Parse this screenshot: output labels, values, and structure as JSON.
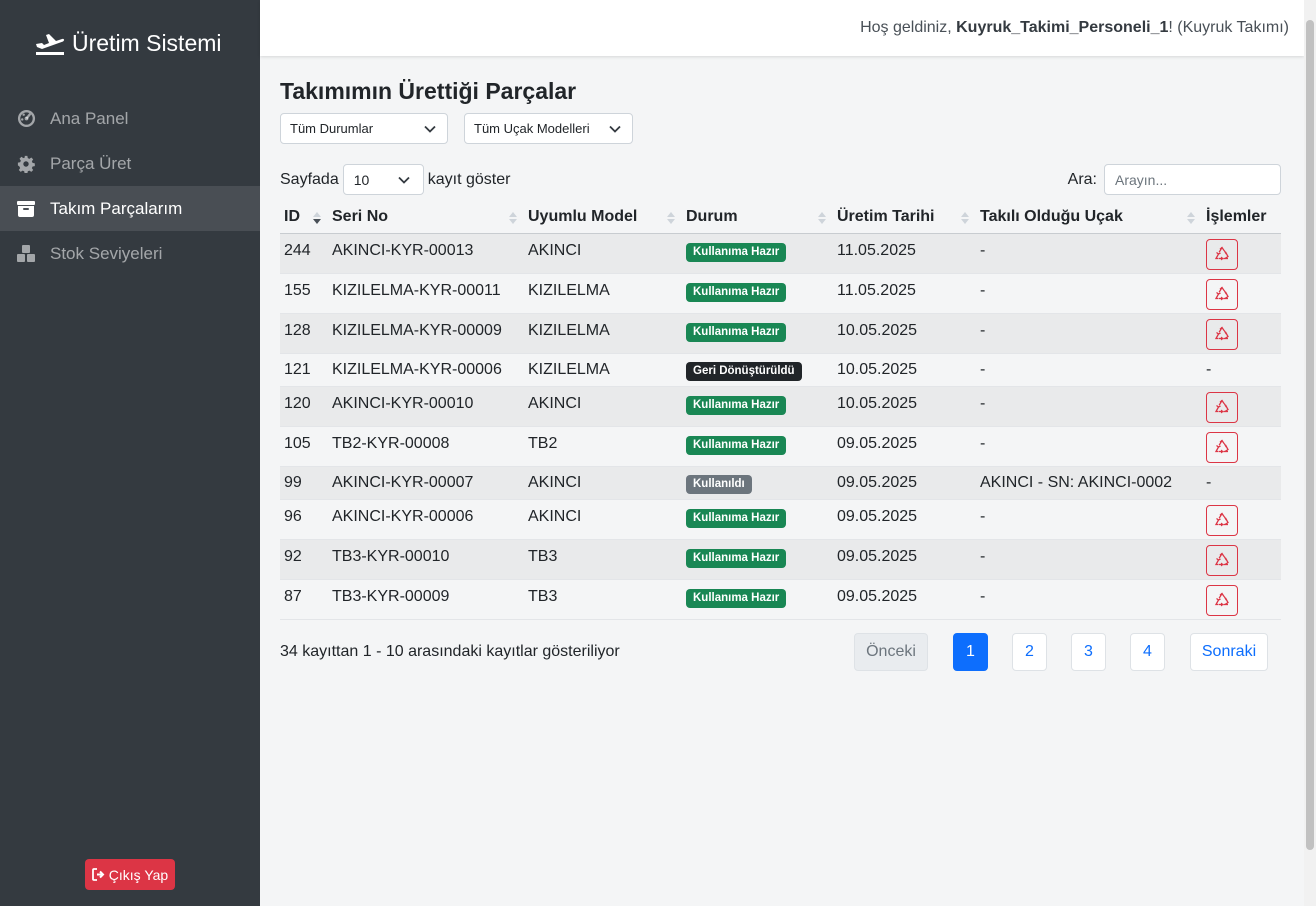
{
  "app": {
    "title": "Üretim Sistemi",
    "logo_icon": "plane-icon"
  },
  "sidebar": {
    "items": [
      {
        "label": "Ana Panel",
        "icon": "dashboard-icon",
        "active": false
      },
      {
        "label": "Parça Üret",
        "icon": "gear-icon",
        "active": false
      },
      {
        "label": "Takım Parçalarım",
        "icon": "archive-icon",
        "active": true
      },
      {
        "label": "Stok Seviyeleri",
        "icon": "cubes-icon",
        "active": false
      }
    ],
    "logout_label": "Çıkış Yap"
  },
  "header": {
    "welcome_prefix": "Hoş geldiniz, ",
    "username": "Kuyruk_Takimi_Personeli_1",
    "welcome_suffix": "! (Kuyruk Takımı)"
  },
  "page": {
    "title": "Takımımın Ürettiği Parçalar",
    "status_filter": "Tüm Durumlar",
    "model_filter": "Tüm Uçak Modelleri",
    "length_prefix": "Sayfada",
    "length_value": "10",
    "length_suffix": "kayıt göster",
    "search_label": "Ara:",
    "search_placeholder": "Arayın..."
  },
  "table": {
    "columns": [
      "ID",
      "Seri No",
      "Uyumlu Model",
      "Durum",
      "Üretim Tarihi",
      "Takılı Olduğu Uçak",
      "İşlemler"
    ],
    "rows": [
      {
        "id": "244",
        "serial": "AKINCI-KYR-00013",
        "model": "AKINCI",
        "status": "Kullanıma Hazır",
        "status_type": "success",
        "date": "11.05.2025",
        "aircraft": "-",
        "action": "recycle"
      },
      {
        "id": "155",
        "serial": "KIZILELMA-KYR-00011",
        "model": "KIZILELMA",
        "status": "Kullanıma Hazır",
        "status_type": "success",
        "date": "11.05.2025",
        "aircraft": "-",
        "action": "recycle"
      },
      {
        "id": "128",
        "serial": "KIZILELMA-KYR-00009",
        "model": "KIZILELMA",
        "status": "Kullanıma Hazır",
        "status_type": "success",
        "date": "10.05.2025",
        "aircraft": "-",
        "action": "recycle"
      },
      {
        "id": "121",
        "serial": "KIZILELMA-KYR-00006",
        "model": "KIZILELMA",
        "status": "Geri Dönüştürüldü",
        "status_type": "dark",
        "date": "10.05.2025",
        "aircraft": "-",
        "action": "-"
      },
      {
        "id": "120",
        "serial": "AKINCI-KYR-00010",
        "model": "AKINCI",
        "status": "Kullanıma Hazır",
        "status_type": "success",
        "date": "10.05.2025",
        "aircraft": "-",
        "action": "recycle"
      },
      {
        "id": "105",
        "serial": "TB2-KYR-00008",
        "model": "TB2",
        "status": "Kullanıma Hazır",
        "status_type": "success",
        "date": "09.05.2025",
        "aircraft": "-",
        "action": "recycle"
      },
      {
        "id": "99",
        "serial": "AKINCI-KYR-00007",
        "model": "AKINCI",
        "status": "Kullanıldı",
        "status_type": "secondary",
        "date": "09.05.2025",
        "aircraft": "AKINCI - SN: AKINCI-0002",
        "action": "-"
      },
      {
        "id": "96",
        "serial": "AKINCI-KYR-00006",
        "model": "AKINCI",
        "status": "Kullanıma Hazır",
        "status_type": "success",
        "date": "09.05.2025",
        "aircraft": "-",
        "action": "recycle"
      },
      {
        "id": "92",
        "serial": "TB3-KYR-00010",
        "model": "TB3",
        "status": "Kullanıma Hazır",
        "status_type": "success",
        "date": "09.05.2025",
        "aircraft": "-",
        "action": "recycle"
      },
      {
        "id": "87",
        "serial": "TB3-KYR-00009",
        "model": "TB3",
        "status": "Kullanıma Hazır",
        "status_type": "success",
        "date": "09.05.2025",
        "aircraft": "-",
        "action": "recycle"
      }
    ]
  },
  "footer": {
    "info": "34 kayıttan 1 - 10 arasındaki kayıtlar gösteriliyor",
    "prev": "Önceki",
    "pages": [
      "1",
      "2",
      "3",
      "4"
    ],
    "current_page": "1",
    "next": "Sonraki"
  },
  "colors": {
    "sidebar_bg": "#343a40",
    "success": "#198754",
    "dark": "#212529",
    "secondary": "#6c757d",
    "danger": "#dc3545",
    "primary": "#0d6efd"
  }
}
